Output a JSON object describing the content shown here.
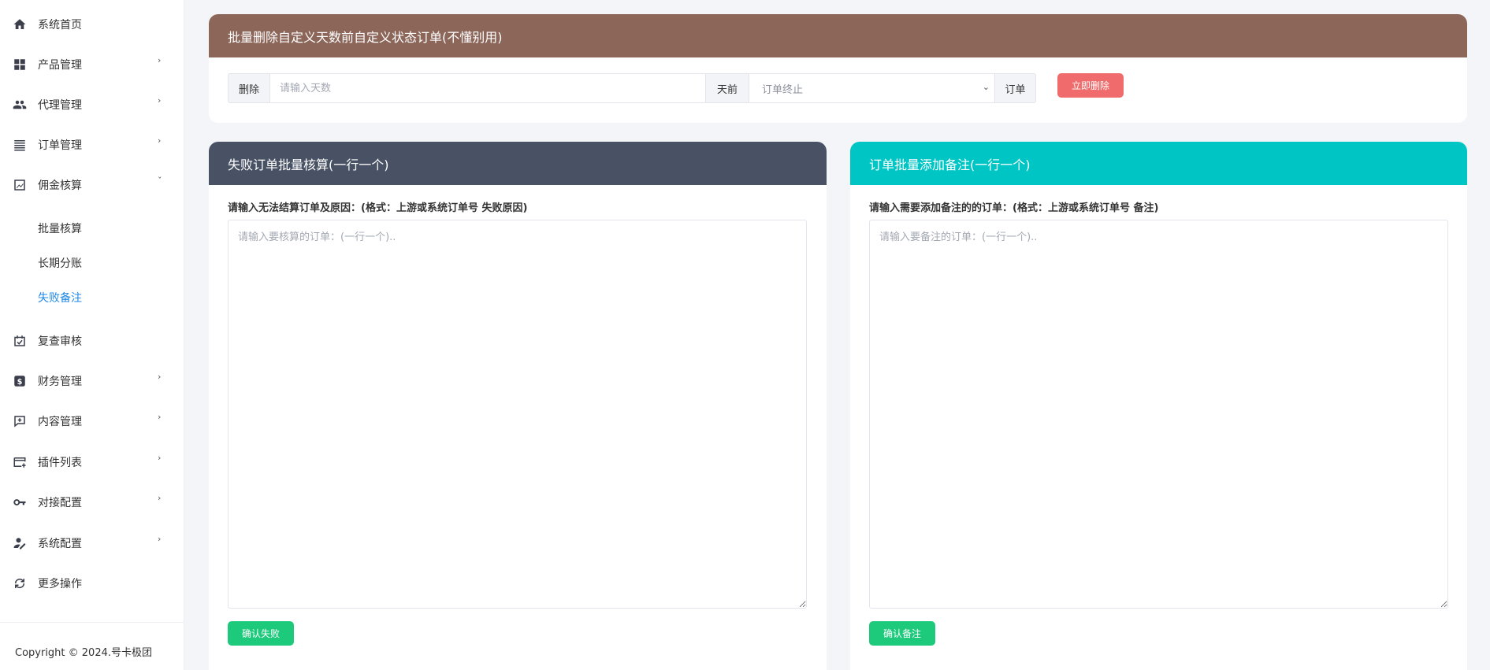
{
  "sidebar": {
    "items": [
      {
        "label": "系统首页",
        "icon": "home-icon"
      },
      {
        "label": "产品管理",
        "icon": "grid-icon"
      },
      {
        "label": "代理管理",
        "icon": "users-icon"
      },
      {
        "label": "订单管理",
        "icon": "list-icon"
      },
      {
        "label": "佣金核算",
        "icon": "chart-icon"
      },
      {
        "label": "复查审核",
        "icon": "calendar-check-icon"
      },
      {
        "label": "财务管理",
        "icon": "dollar-icon"
      },
      {
        "label": "内容管理",
        "icon": "add-comment-icon"
      },
      {
        "label": "插件列表",
        "icon": "card-add-icon"
      },
      {
        "label": "对接配置",
        "icon": "key-icon"
      },
      {
        "label": "系统配置",
        "icon": "user-edit-icon"
      },
      {
        "label": "更多操作",
        "icon": "sync-icon"
      }
    ],
    "sub_items": [
      {
        "label": "批量核算"
      },
      {
        "label": "长期分账"
      },
      {
        "label": "失败备注"
      }
    ],
    "copyright": "Copyright © 2024.号卡极团"
  },
  "bulk_delete": {
    "title": "批量删除自定义天数前自定义状态订单(不懂别用)",
    "delete_addon": "删除",
    "days_placeholder": "请输入天数",
    "days_addon": "天前",
    "status_selected": "订单终止",
    "order_addon": "订单",
    "submit_label": "立即删除"
  },
  "fail_panel": {
    "title": "失败订单批量核算(一行一个)",
    "label": "请输入无法结算订单及原因：(格式：上游或系统订单号 失败原因)",
    "placeholder": "请输入要核算的订单：(一行一个)..",
    "submit_label": "确认失败"
  },
  "remark_panel": {
    "title": "订单批量添加备注(一行一个)",
    "label": "请输入需要添加备注的的订单：(格式：上游或系统订单号 备注)",
    "placeholder": "请输入要备注的订单：(一行一个)..",
    "submit_label": "确认备注"
  },
  "colors": {
    "delete_header": "#8c6659",
    "fail_header": "#485264",
    "remark_header": "#00c5c5",
    "danger_button": "#f06b6b",
    "success_button": "#1dc97a",
    "active_link": "#1e88e5"
  }
}
